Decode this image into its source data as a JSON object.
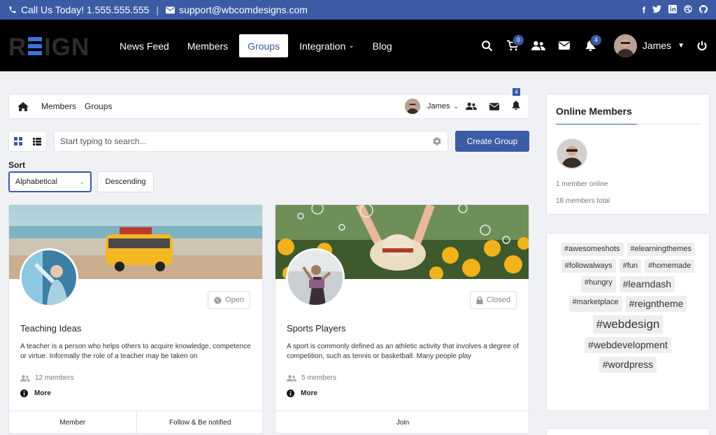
{
  "topbar": {
    "phone": "Call Us Today! 1.555.555.555",
    "email": "support@wbcomdesigns.com",
    "social": [
      "facebook-icon",
      "twitter-icon",
      "linkedin-icon",
      "dribbble-icon",
      "github-icon"
    ]
  },
  "nav": {
    "logo": "REIGN",
    "links": [
      {
        "label": "News Feed",
        "active": false
      },
      {
        "label": "Members",
        "active": false
      },
      {
        "label": "Groups",
        "active": true
      },
      {
        "label": "Integration",
        "active": false,
        "dropdown": true
      },
      {
        "label": "Blog",
        "active": false
      }
    ],
    "cart_count": "0",
    "notification_count": "4",
    "user_name": "James"
  },
  "breadcrumb": {
    "items": [
      "Members",
      "Groups"
    ],
    "user_name": "James",
    "notification_count": "4"
  },
  "search": {
    "placeholder": "Start typing to search..."
  },
  "create_group_label": "Create Group",
  "sort": {
    "label": "Sort",
    "selected": "Alphabetical",
    "order": "Descending"
  },
  "groups": [
    {
      "title": "Teaching Ideas",
      "status": "Open",
      "description": "A teacher is a person who helps others to acquire knowledge, competence or virtue. Informally the role of a teacher may be taken on",
      "members": "12 members",
      "more": "More",
      "actions": [
        "Member",
        "Follow & Be notified"
      ]
    },
    {
      "title": "Sports Players",
      "status": "Closed",
      "description": "A sport is commonly defined as an athletic activity that involves a degree of competition, such as tennis or basketball. Many people play",
      "members": "5 members",
      "more": "More",
      "actions": [
        "Join"
      ]
    }
  ],
  "online": {
    "title": "Online Members",
    "online_count": "1 member online",
    "total": "18 members total"
  },
  "tags": [
    {
      "label": "#awesomeshots",
      "size": 11
    },
    {
      "label": "#elearningthemes",
      "size": 11
    },
    {
      "label": "#followalways",
      "size": 11
    },
    {
      "label": "#fun",
      "size": 11
    },
    {
      "label": "#homemade",
      "size": 11
    },
    {
      "label": "#hungry",
      "size": 11
    },
    {
      "label": "#learndash",
      "size": 14
    },
    {
      "label": "#marketplace",
      "size": 11
    },
    {
      "label": "#reigntheme",
      "size": 14
    },
    {
      "label": "#webdesign",
      "size": 17
    },
    {
      "label": "#webdevelopment",
      "size": 14
    },
    {
      "label": "#wordpress",
      "size": 14
    }
  ],
  "colors": {
    "accent": "#3b5ba5",
    "nav_bg": "#000000"
  }
}
